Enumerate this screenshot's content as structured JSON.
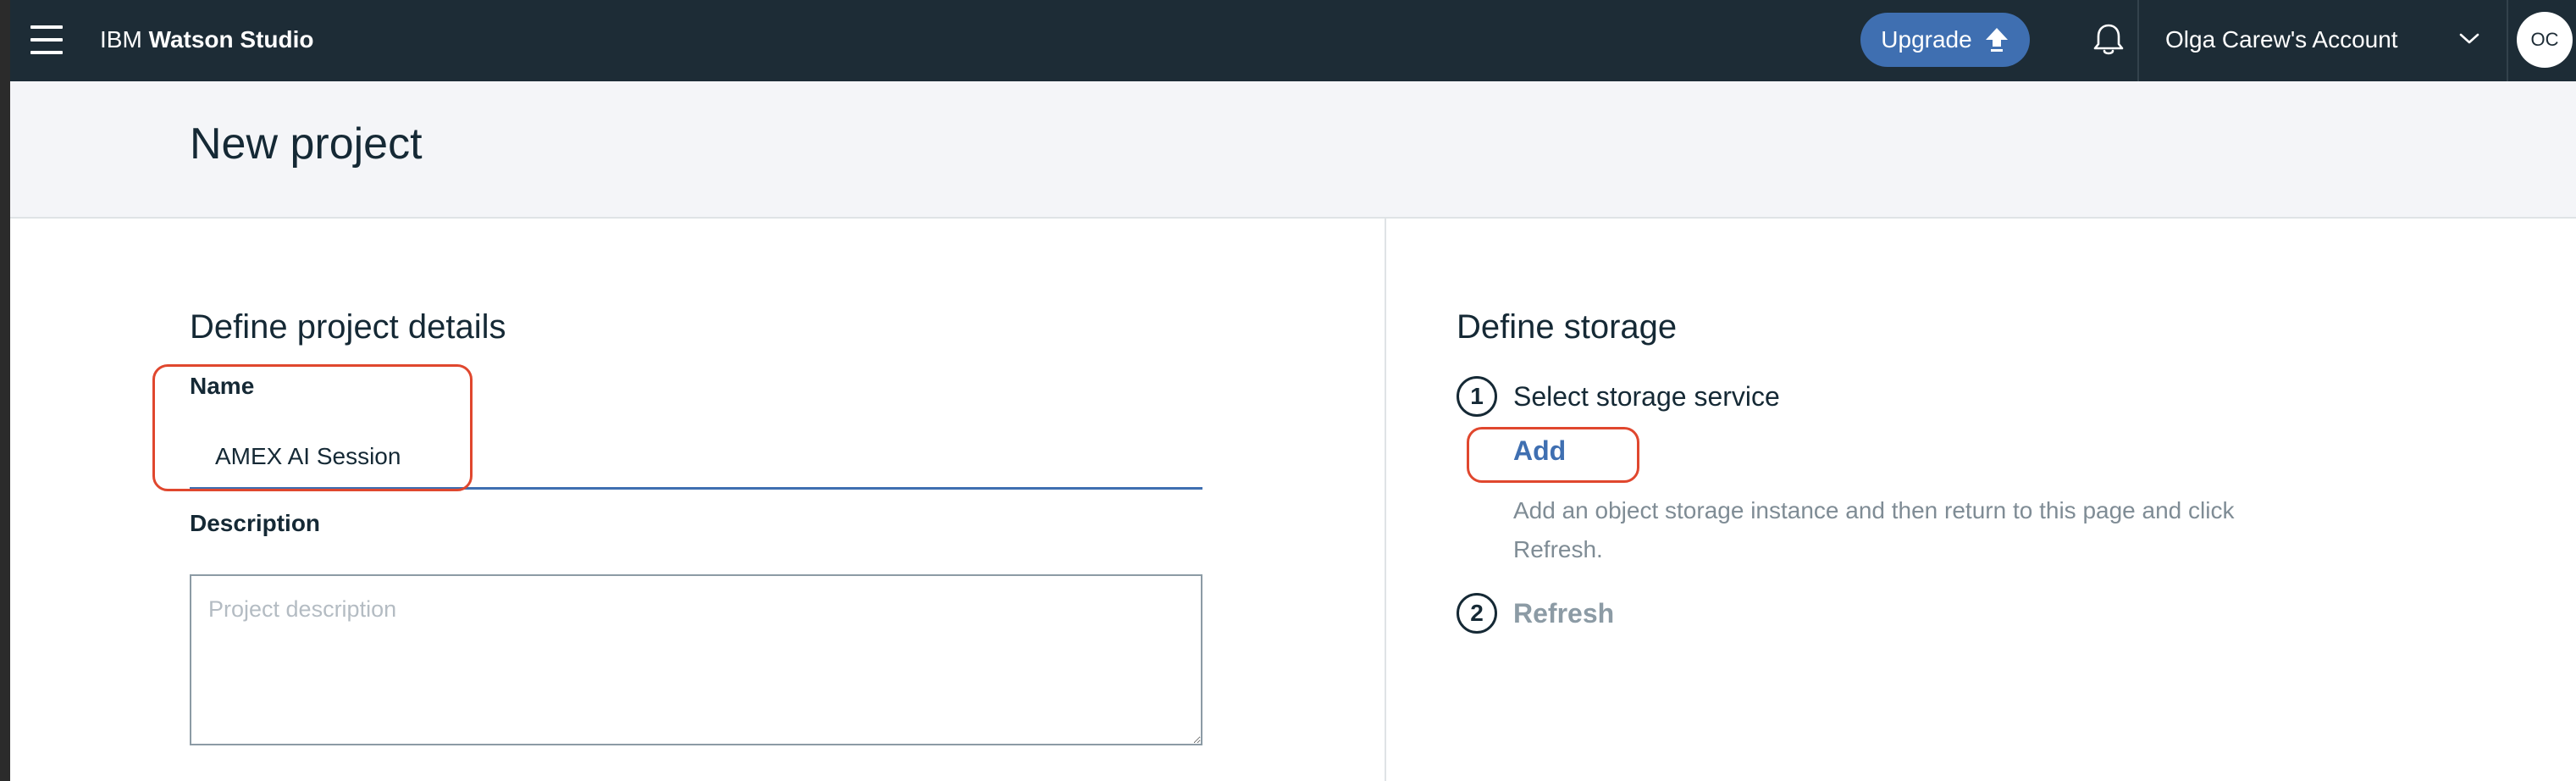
{
  "topbar": {
    "brand_prefix": "IBM",
    "brand_name": "Watson Studio",
    "upgrade_label": "Upgrade",
    "account_name": "Olga Carew's Account",
    "avatar_initials": "OC"
  },
  "page": {
    "title": "New project"
  },
  "project_details": {
    "section_title": "Define project details",
    "name_label": "Name",
    "name_value": "AMEX AI Session",
    "description_label": "Description",
    "description_placeholder": "Project description"
  },
  "storage": {
    "section_title": "Define storage",
    "step1_number": "1",
    "step1_label": "Select storage service",
    "add_label": "Add",
    "help_text": "Add an object storage instance and then return to this page and click Refresh.",
    "step2_number": "2",
    "refresh_label": "Refresh"
  },
  "colors": {
    "topbar_bg": "#1d2c36",
    "accent": "#3f6fb1",
    "highlight": "#e0472e"
  }
}
